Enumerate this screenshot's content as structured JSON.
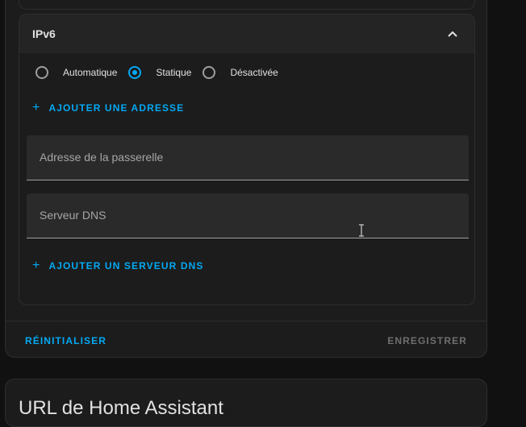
{
  "ipv6": {
    "title": "IPv6",
    "modes": [
      {
        "label": "Automatique",
        "checked": false
      },
      {
        "label": "Statique",
        "checked": true
      },
      {
        "label": "Désactivée",
        "checked": false
      }
    ],
    "add_address_label": "AJOUTER UNE ADRESSE",
    "gateway_label": "Adresse de la passerelle",
    "dns_label": "Serveur DNS",
    "add_dns_label": "AJOUTER UN SERVEUR DNS"
  },
  "actions": {
    "reset_label": "RÉINITIALISER",
    "save_label": "ENREGISTRER"
  },
  "next_card": {
    "title": "URL de Home Assistant"
  },
  "colors": {
    "accent": "#03a9f4",
    "disabled": "#6f6f6f",
    "card_bg": "#1c1c1c",
    "page_bg": "#111111"
  },
  "icons": {
    "collapse": "chevron-up-icon",
    "add": "plus-icon",
    "cursor": "text-cursor-icon"
  }
}
